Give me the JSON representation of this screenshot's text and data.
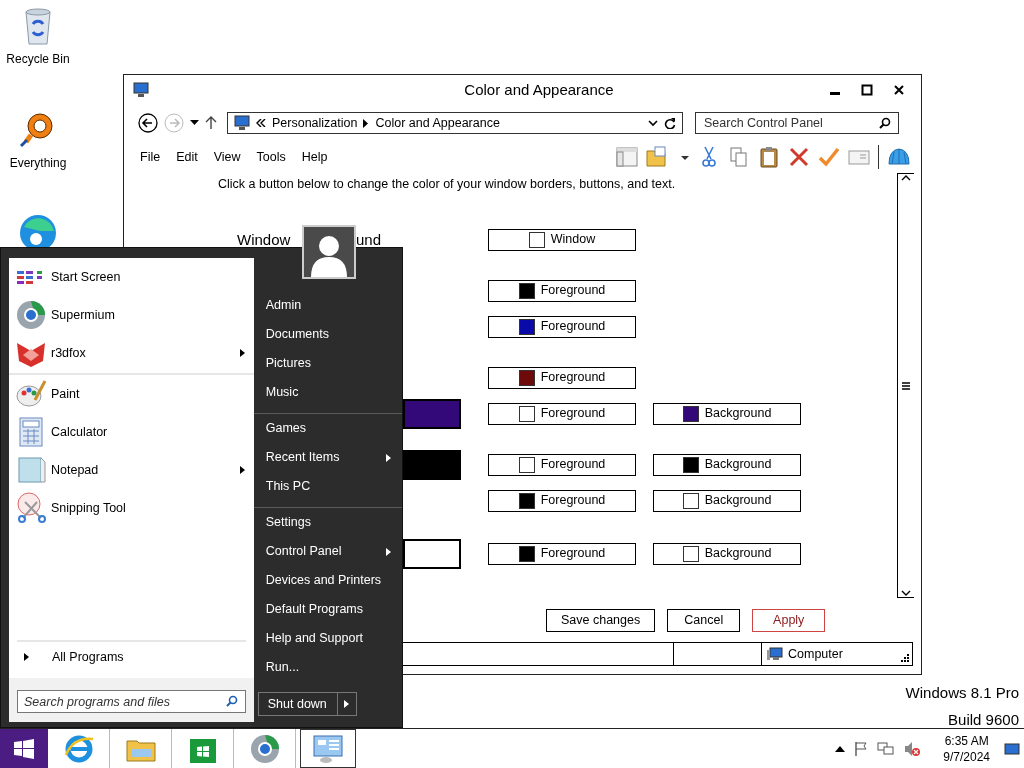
{
  "desktop_icons": [
    {
      "kind": "recycle",
      "label": "Recycle Bin"
    },
    {
      "kind": "everything",
      "label": "Everything"
    },
    {
      "kind": "edge"
    }
  ],
  "window": {
    "title": "Color and Appearance",
    "breadcrumb": [
      "Personalization",
      "Color and Appearance"
    ],
    "search": {
      "placeholder": "Search Control Panel"
    },
    "menu": [
      "File",
      "Edit",
      "View",
      "Tools",
      "Help"
    ],
    "instruction": "Click a button below to change the color of your window borders, buttons, and text.",
    "label_parts": [
      "Window",
      "und"
    ],
    "rows": [
      {
        "buttons": [
          {
            "label": "Window",
            "color": "#ffffff"
          }
        ]
      },
      {
        "buttons": [
          {
            "label": "Foreground",
            "color": "#000000"
          }
        ]
      },
      {
        "buttons": [
          {
            "label": "Foreground",
            "color": "#0a0aa8"
          }
        ]
      },
      {
        "buttons": [
          {
            "label": "Foreground",
            "color": "#6e0a0a"
          }
        ]
      },
      {
        "sample": {
          "color": "#33097a"
        },
        "buttons": [
          {
            "label": "Foreground",
            "color": "#ffffff"
          },
          {
            "label": "Background",
            "color": "#33097a"
          }
        ]
      },
      {
        "sample": {
          "color": "#000000"
        },
        "buttons": [
          {
            "label": "Foreground",
            "color": "#ffffff"
          },
          {
            "label": "Background",
            "color": "#000000"
          }
        ]
      },
      {
        "buttons": [
          {
            "label": "Foreground",
            "color": "#000000"
          },
          {
            "label": "Background",
            "color": "#ffffff"
          }
        ]
      },
      {
        "sample": {
          "color": "#ffffff"
        },
        "buttons": [
          {
            "label": "Foreground",
            "color": "#000000"
          },
          {
            "label": "Background",
            "color": "#ffffff"
          }
        ]
      }
    ],
    "actions": [
      {
        "label": "Save changes",
        "default": false
      },
      {
        "label": "Cancel",
        "default": false
      },
      {
        "label": "Apply",
        "default": true
      }
    ],
    "status": "Computer"
  },
  "start_menu": {
    "programs": [
      {
        "kind": "startscreen",
        "label": "Start Screen",
        "submenu": false,
        "group_end": false
      },
      {
        "kind": "supermium",
        "label": "Supermium",
        "submenu": false,
        "group_end": false
      },
      {
        "kind": "r3dfox",
        "label": "r3dfox",
        "submenu": true,
        "group_end": true
      },
      {
        "kind": "paint",
        "label": "Paint",
        "submenu": false,
        "group_end": false
      },
      {
        "kind": "calculator",
        "label": "Calculator",
        "submenu": false,
        "group_end": false
      },
      {
        "kind": "notepad",
        "label": "Notepad",
        "submenu": true,
        "group_end": false
      },
      {
        "kind": "snipping",
        "label": "Snipping Tool",
        "submenu": false,
        "group_end": false
      }
    ],
    "all_programs": "All Programs",
    "search": {
      "placeholder": "Search programs and files"
    },
    "places": [
      {
        "label": "Admin",
        "submenu": false,
        "group_end": false
      },
      {
        "label": "Documents",
        "submenu": false,
        "group_end": false
      },
      {
        "label": "Pictures",
        "submenu": false,
        "group_end": false
      },
      {
        "label": "Music",
        "submenu": false,
        "group_end": true
      },
      {
        "label": "Games",
        "submenu": false,
        "group_end": false
      },
      {
        "label": "Recent Items",
        "submenu": true,
        "group_end": false
      },
      {
        "label": "This PC",
        "submenu": false,
        "group_end": true
      },
      {
        "label": "Settings",
        "submenu": false,
        "group_end": false
      },
      {
        "label": "Control Panel",
        "submenu": true,
        "group_end": false
      },
      {
        "label": "Devices and Printers",
        "submenu": false,
        "group_end": false
      },
      {
        "label": "Default Programs",
        "submenu": false,
        "group_end": false
      },
      {
        "label": "Help and Support",
        "submenu": false,
        "group_end": false
      },
      {
        "label": "Run...",
        "submenu": false,
        "group_end": false
      }
    ],
    "shutdown": "Shut down"
  },
  "edition": [
    "Windows 8.1 Pro",
    "Build 9600"
  ],
  "taskbar": {
    "pinned": [
      {
        "kind": "ie",
        "active": false
      },
      {
        "kind": "explorer",
        "active": false
      },
      {
        "kind": "store",
        "active": false
      },
      {
        "kind": "supermium",
        "active": false
      },
      {
        "kind": "controlpanel",
        "active": true
      }
    ],
    "time": "6:35 AM",
    "date": "9/7/2024"
  }
}
